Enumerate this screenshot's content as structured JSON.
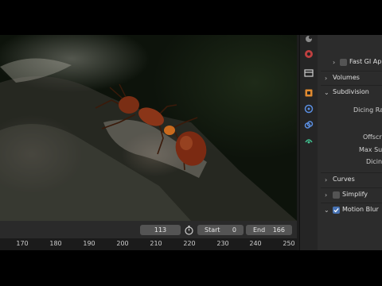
{
  "timeline": {
    "current_frame": "113",
    "start_label": "Start",
    "start_value": "0",
    "end_label": "End",
    "end_value": "166",
    "ruler_ticks": [
      "170",
      "180",
      "190",
      "200",
      "210",
      "220",
      "230",
      "240",
      "250"
    ]
  },
  "properties": {
    "fast_gi_label": "Fast GI App",
    "volumes_label": "Volumes",
    "subdivision_label": "Subdivision",
    "dicing_rate_label": "Dicing Rat",
    "offscreen_label": "Offscre",
    "max_sub_label": "Max Sub",
    "dicing_label": "Dicin",
    "curves_label": "Curves",
    "simplify_label": "Simplify",
    "motion_blur_label": "Motion Blur"
  },
  "icons": [
    "world-icon",
    "output-icon",
    "view-layer-icon",
    "object-icon",
    "physics-icon",
    "constraint-icon",
    "data-icon",
    "stopwatch-icon",
    "chevron-right-icon",
    "chevron-down-icon"
  ],
  "colors": {
    "accent": "#4772b3"
  }
}
